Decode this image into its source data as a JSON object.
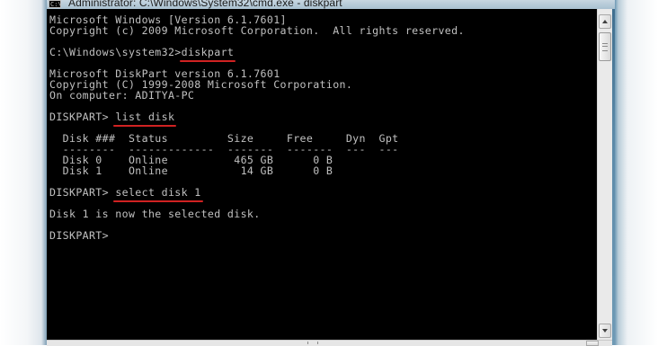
{
  "window": {
    "title": "Administrator: C:\\Windows\\System32\\cmd.exe - diskpart",
    "icon_name": "cmd-icon",
    "icon_text": "C:\\"
  },
  "console": {
    "lines": [
      "Microsoft Windows [Version 6.1.7601]",
      "Copyright (c) 2009 Microsoft Corporation.  All rights reserved.",
      "",
      "C:\\Windows\\system32>diskpart",
      "",
      "Microsoft DiskPart version 6.1.7601",
      "Copyright (C) 1999-2008 Microsoft Corporation.",
      "On computer: ADITYA-PC",
      "",
      "DISKPART> list disk",
      "",
      "  Disk ###  Status         Size     Free     Dyn  Gpt",
      "  --------  -------------  -------  -------  ---  ---",
      "  Disk 0    Online          465 GB      0 B",
      "  Disk 1    Online           14 GB      0 B",
      "",
      "DISKPART> select disk 1",
      "",
      "Disk 1 is now the selected disk.",
      "",
      "DISKPART> "
    ],
    "commands": {
      "cmd1_prompt": "C:\\Windows\\system32>",
      "cmd1": "diskpart",
      "cmd2_prompt": "DISKPART> ",
      "cmd2": "list disk",
      "cmd3_prompt": "DISKPART> ",
      "cmd3": "select disk 1"
    },
    "text_color": "#c0c0c0",
    "background_color": "#000000",
    "underline_color": "#d02222"
  }
}
